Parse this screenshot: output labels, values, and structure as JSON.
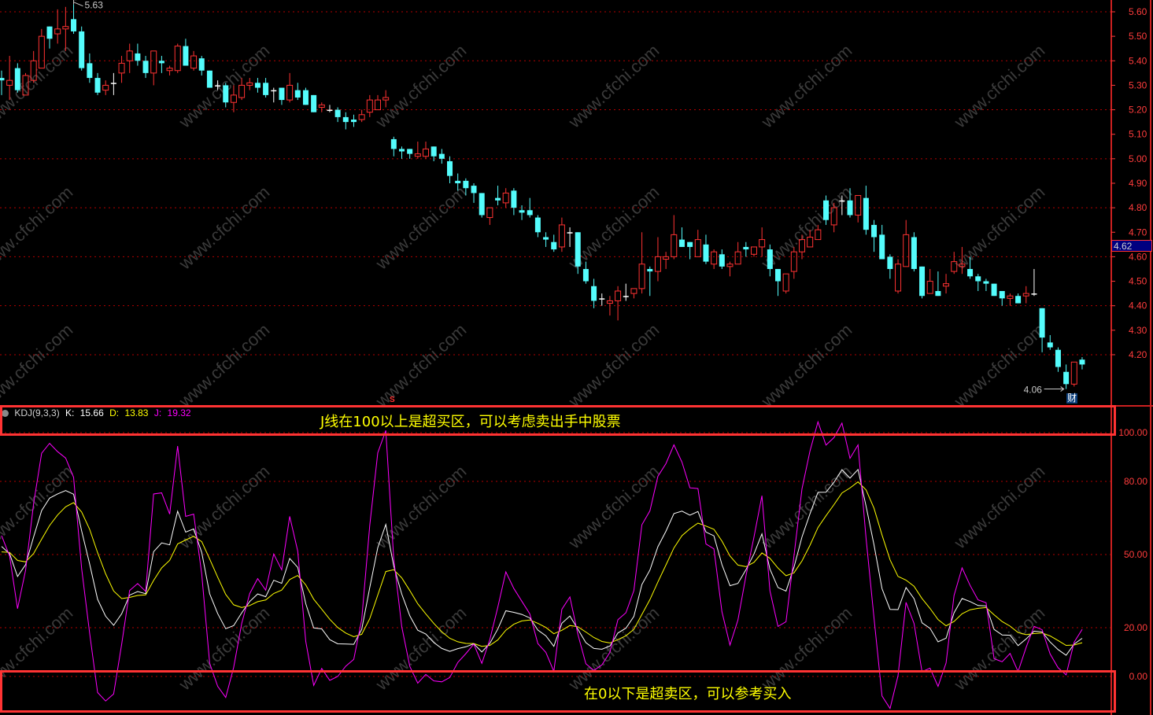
{
  "chart_data": {
    "type": "candlestick",
    "price_axis": {
      "min": 4.2,
      "max": 5.6,
      "step": 0.1,
      "ticks": [
        "5.60",
        "5.50",
        "5.40",
        "5.30",
        "5.20",
        "5.10",
        "5.00",
        "4.90",
        "4.80",
        "4.70",
        "4.60",
        "4.50",
        "4.40",
        "4.30",
        "4.20"
      ]
    },
    "high_label": "5.63",
    "low_label": "4.06",
    "current_price": "4.62",
    "candles_ohlc": [
      [
        5.33,
        5.36,
        5.26,
        5.32
      ],
      [
        5.3,
        5.42,
        5.24,
        5.32
      ],
      [
        5.37,
        5.39,
        5.27,
        5.28
      ],
      [
        5.26,
        5.35,
        5.26,
        5.34
      ],
      [
        5.32,
        5.44,
        5.31,
        5.4
      ],
      [
        5.37,
        5.53,
        5.37,
        5.5
      ],
      [
        5.54,
        5.54,
        5.45,
        5.49
      ],
      [
        5.51,
        5.61,
        5.47,
        5.53
      ],
      [
        5.53,
        5.62,
        5.44,
        5.54
      ],
      [
        5.57,
        5.63,
        5.51,
        5.52
      ],
      [
        5.52,
        5.54,
        5.36,
        5.37
      ],
      [
        5.39,
        5.43,
        5.31,
        5.33
      ],
      [
        5.33,
        5.35,
        5.26,
        5.27
      ],
      [
        5.28,
        5.32,
        5.26,
        5.3
      ],
      [
        5.31,
        5.35,
        5.26,
        5.31
      ],
      [
        5.35,
        5.42,
        5.31,
        5.39
      ],
      [
        5.4,
        5.47,
        5.35,
        5.44
      ],
      [
        5.43,
        5.47,
        5.38,
        5.4
      ],
      [
        5.4,
        5.42,
        5.33,
        5.35
      ],
      [
        5.35,
        5.44,
        5.3,
        5.44
      ],
      [
        5.4,
        5.42,
        5.35,
        5.39
      ],
      [
        5.36,
        5.38,
        5.34,
        5.37
      ],
      [
        5.36,
        5.47,
        5.35,
        5.46
      ],
      [
        5.46,
        5.49,
        5.38,
        5.38
      ],
      [
        5.37,
        5.44,
        5.36,
        5.42
      ],
      [
        5.41,
        5.42,
        5.34,
        5.36
      ],
      [
        5.36,
        5.36,
        5.29,
        5.29
      ],
      [
        5.3,
        5.32,
        5.28,
        5.3
      ],
      [
        5.3,
        5.31,
        5.21,
        5.23
      ],
      [
        5.23,
        5.3,
        5.19,
        5.26
      ],
      [
        5.25,
        5.33,
        5.24,
        5.3
      ],
      [
        5.3,
        5.33,
        5.28,
        5.31
      ],
      [
        5.31,
        5.33,
        5.27,
        5.29
      ],
      [
        5.31,
        5.33,
        5.25,
        5.26
      ],
      [
        5.28,
        5.29,
        5.23,
        5.28
      ],
      [
        5.29,
        5.29,
        5.22,
        5.24
      ],
      [
        5.24,
        5.35,
        5.23,
        5.3
      ],
      [
        5.28,
        5.31,
        5.24,
        5.25
      ],
      [
        5.28,
        5.29,
        5.22,
        5.22
      ],
      [
        5.26,
        5.26,
        5.19,
        5.19
      ],
      [
        5.21,
        5.23,
        5.19,
        5.22
      ],
      [
        5.2,
        5.22,
        5.19,
        5.2
      ],
      [
        5.2,
        5.21,
        5.15,
        5.17
      ],
      [
        5.17,
        5.19,
        5.12,
        5.15
      ],
      [
        5.16,
        5.18,
        5.13,
        5.15
      ],
      [
        5.16,
        5.2,
        5.15,
        5.18
      ],
      [
        5.19,
        5.26,
        5.17,
        5.24
      ],
      [
        5.2,
        5.26,
        5.2,
        5.24
      ],
      [
        5.24,
        5.28,
        5.21,
        5.25
      ],
      [
        5.08,
        5.09,
        5.01,
        5.04
      ],
      [
        5.04,
        5.05,
        5.0,
        5.03
      ],
      [
        5.04,
        5.04,
        5.0,
        5.02
      ],
      [
        5.01,
        5.07,
        5.0,
        5.02
      ],
      [
        5.01,
        5.07,
        5.0,
        5.04
      ],
      [
        5.05,
        5.05,
        4.99,
        5.01
      ],
      [
        5.02,
        5.04,
        4.98,
        5.0
      ],
      [
        4.99,
        5.01,
        4.9,
        4.93
      ],
      [
        4.91,
        4.94,
        4.87,
        4.9
      ],
      [
        4.91,
        4.92,
        4.85,
        4.88
      ],
      [
        4.89,
        4.9,
        4.82,
        4.86
      ],
      [
        4.86,
        4.86,
        4.76,
        4.77
      ],
      [
        4.76,
        4.8,
        4.73,
        4.8
      ],
      [
        4.84,
        4.89,
        4.81,
        4.83
      ],
      [
        4.82,
        4.88,
        4.8,
        4.86
      ],
      [
        4.87,
        4.88,
        4.77,
        4.8
      ],
      [
        4.79,
        4.81,
        4.75,
        4.78
      ],
      [
        4.79,
        4.84,
        4.76,
        4.77
      ],
      [
        4.76,
        4.77,
        4.68,
        4.7
      ],
      [
        4.68,
        4.7,
        4.64,
        4.67
      ],
      [
        4.66,
        4.69,
        4.62,
        4.63
      ],
      [
        4.64,
        4.76,
        4.62,
        4.73
      ],
      [
        4.7,
        4.72,
        4.64,
        4.7
      ],
      [
        4.7,
        4.7,
        4.53,
        4.56
      ],
      [
        4.55,
        4.58,
        4.49,
        4.5
      ],
      [
        4.48,
        4.51,
        4.39,
        4.42
      ],
      [
        4.43,
        4.45,
        4.4,
        4.43
      ],
      [
        4.41,
        4.44,
        4.36,
        4.42
      ],
      [
        4.42,
        4.48,
        4.34,
        4.46
      ],
      [
        4.44,
        4.49,
        4.42,
        4.44
      ],
      [
        4.45,
        4.47,
        4.43,
        4.47
      ],
      [
        4.47,
        4.7,
        4.45,
        4.57
      ],
      [
        4.55,
        4.56,
        4.44,
        4.54
      ],
      [
        4.54,
        4.68,
        4.5,
        4.6
      ],
      [
        4.59,
        4.62,
        4.55,
        4.6
      ],
      [
        4.6,
        4.77,
        4.59,
        4.69
      ],
      [
        4.67,
        4.72,
        4.64,
        4.64
      ],
      [
        4.66,
        4.66,
        4.59,
        4.64
      ],
      [
        4.6,
        4.71,
        4.6,
        4.67
      ],
      [
        4.65,
        4.69,
        4.57,
        4.58
      ],
      [
        4.57,
        4.63,
        4.55,
        4.62
      ],
      [
        4.61,
        4.63,
        4.55,
        4.56
      ],
      [
        4.56,
        4.58,
        4.52,
        4.57
      ],
      [
        4.57,
        4.66,
        4.57,
        4.62
      ],
      [
        4.64,
        4.66,
        4.6,
        4.63
      ],
      [
        4.61,
        4.64,
        4.6,
        4.64
      ],
      [
        4.64,
        4.72,
        4.6,
        4.67
      ],
      [
        4.63,
        4.65,
        4.52,
        4.55
      ],
      [
        4.55,
        4.55,
        4.44,
        4.5
      ],
      [
        4.46,
        4.53,
        4.45,
        4.53
      ],
      [
        4.54,
        4.64,
        4.51,
        4.62
      ],
      [
        4.62,
        4.69,
        4.59,
        4.67
      ],
      [
        4.64,
        4.71,
        4.64,
        4.68
      ],
      [
        4.67,
        4.73,
        4.67,
        4.71
      ],
      [
        4.83,
        4.85,
        4.73,
        4.75
      ],
      [
        4.73,
        4.82,
        4.7,
        4.8
      ],
      [
        4.83,
        4.85,
        4.77,
        4.83
      ],
      [
        4.83,
        4.88,
        4.76,
        4.77
      ],
      [
        4.77,
        4.85,
        4.74,
        4.85
      ],
      [
        4.84,
        4.89,
        4.69,
        4.71
      ],
      [
        4.73,
        4.75,
        4.62,
        4.68
      ],
      [
        4.69,
        4.73,
        4.59,
        4.59
      ],
      [
        4.6,
        4.61,
        4.51,
        4.55
      ],
      [
        4.46,
        4.59,
        4.45,
        4.57
      ],
      [
        4.56,
        4.75,
        4.56,
        4.69
      ],
      [
        4.68,
        4.7,
        4.54,
        4.55
      ],
      [
        4.56,
        4.56,
        4.43,
        4.44
      ],
      [
        4.45,
        4.55,
        4.45,
        4.5
      ],
      [
        4.46,
        4.54,
        4.44,
        4.44
      ],
      [
        4.48,
        4.53,
        4.45,
        4.49
      ],
      [
        4.54,
        4.62,
        4.53,
        4.58
      ],
      [
        4.56,
        4.64,
        4.53,
        4.57
      ],
      [
        4.55,
        4.6,
        4.51,
        4.52
      ],
      [
        4.52,
        4.53,
        4.46,
        4.5
      ],
      [
        4.5,
        4.51,
        4.46,
        4.49
      ],
      [
        4.49,
        4.49,
        4.44,
        4.44
      ],
      [
        4.46,
        4.46,
        4.4,
        4.43
      ],
      [
        4.43,
        4.45,
        4.4,
        4.44
      ],
      [
        4.44,
        4.45,
        4.41,
        4.41
      ],
      [
        4.44,
        4.48,
        4.41,
        4.45
      ],
      [
        4.45,
        4.55,
        4.44,
        4.45
      ],
      [
        4.39,
        4.39,
        4.21,
        4.27
      ],
      [
        4.25,
        4.28,
        4.22,
        4.23
      ],
      [
        4.22,
        4.23,
        4.13,
        4.15
      ],
      [
        4.13,
        4.16,
        4.06,
        4.08
      ],
      [
        4.08,
        4.17,
        4.07,
        4.17
      ],
      [
        4.18,
        4.19,
        4.14,
        4.16
      ]
    ],
    "indicator": {
      "name": "KDJ(9,3,3)",
      "k_label": "K:",
      "k_value": "15.66",
      "d_label": "D:",
      "d_value": "13.83",
      "j_label": "J:",
      "j_value": "19.32",
      "axis": {
        "min": 0,
        "max": 100,
        "ticks": [
          "100.00",
          "80.00",
          "50.00",
          "20.00",
          "0.00"
        ],
        "tick_values": [
          100,
          80,
          50,
          20,
          0
        ]
      },
      "params": [
        9,
        3,
        3
      ]
    },
    "colors": {
      "up": "#ff3232",
      "down": "#54fcfc",
      "flat": "#ffffff",
      "k": "#ffffff",
      "d": "#ffff00",
      "j": "#ff00ff",
      "grid": "#b40000",
      "axis": "#ff3c3c"
    }
  },
  "annotations": {
    "overbought": "J线在100以上是超买区，可以考虑卖出手中股票",
    "oversold": "在0以下是超卖区，可以参考买入"
  },
  "markers": {
    "finance": "财",
    "signal": "S"
  },
  "watermark": "www.cfchi.com"
}
